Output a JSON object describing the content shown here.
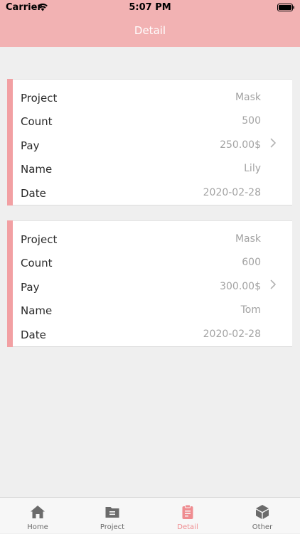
{
  "status_bar": {
    "carrier": "Carrier",
    "time": "5:07 PM"
  },
  "nav": {
    "title": "Detail"
  },
  "colors": {
    "header": "#f2b2b3",
    "accent": "#f2a0a3",
    "active_tab": "#ef8c90",
    "inactive_tab": "#6b6b6b"
  },
  "records": [
    {
      "rows": [
        {
          "label": "Project",
          "value": "Mask"
        },
        {
          "label": "Count",
          "value": "500"
        },
        {
          "label": "Pay",
          "value": "250.00$"
        },
        {
          "label": "Name",
          "value": "Lily"
        },
        {
          "label": "Date",
          "value": "2020-02-28"
        }
      ]
    },
    {
      "rows": [
        {
          "label": "Project",
          "value": "Mask"
        },
        {
          "label": "Count",
          "value": "600"
        },
        {
          "label": "Pay",
          "value": "300.00$"
        },
        {
          "label": "Name",
          "value": "Tom"
        },
        {
          "label": "Date",
          "value": "2020-02-28"
        }
      ]
    }
  ],
  "tabbar": {
    "tabs": [
      {
        "label": "Home",
        "icon": "home-icon",
        "active": false
      },
      {
        "label": "Project",
        "icon": "folder-icon",
        "active": false
      },
      {
        "label": "Detail",
        "icon": "clipboard-icon",
        "active": true
      },
      {
        "label": "Other",
        "icon": "cube-icon",
        "active": false
      }
    ]
  }
}
